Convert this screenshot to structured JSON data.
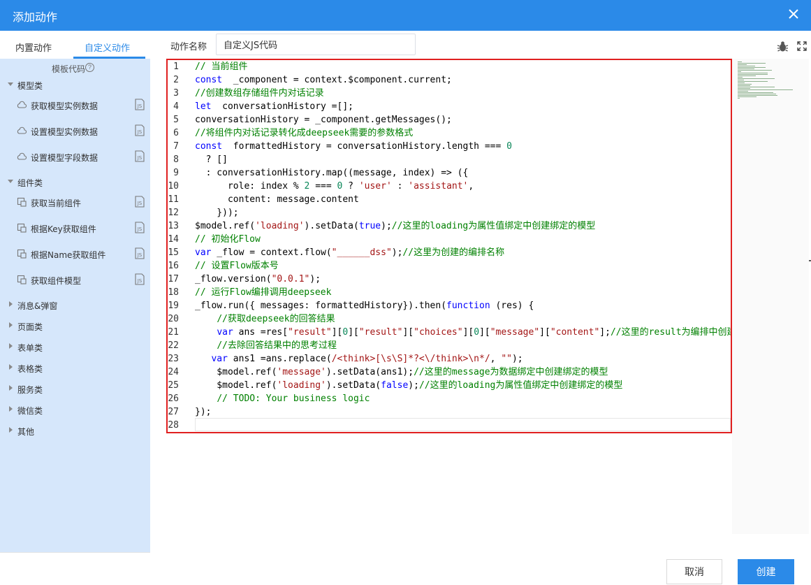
{
  "dialog": {
    "title": "添加动作",
    "cancel_label": "取消",
    "create_label": "创建"
  },
  "sidebar": {
    "tabs": [
      {
        "label": "内置动作",
        "active": false
      },
      {
        "label": "自定义动作",
        "active": true
      }
    ],
    "template_title": "模板代码",
    "help_glyph": "?",
    "categories": [
      {
        "label": "模型类",
        "expanded": true,
        "items": [
          "获取模型实例数据",
          "设置模型实例数据",
          "设置模型字段数据"
        ]
      },
      {
        "label": "组件类",
        "expanded": true,
        "items": [
          "获取当前组件",
          "根据Key获取组件",
          "根据Name获取组件",
          "获取组件模型"
        ]
      },
      {
        "label": "消息&弹窗",
        "expanded": false,
        "items": []
      },
      {
        "label": "页面类",
        "expanded": false,
        "items": []
      },
      {
        "label": "表单类",
        "expanded": false,
        "items": []
      },
      {
        "label": "表格类",
        "expanded": false,
        "items": []
      },
      {
        "label": "服务类",
        "expanded": false,
        "items": []
      },
      {
        "label": "微信类",
        "expanded": false,
        "items": []
      },
      {
        "label": "其他",
        "expanded": false,
        "items": []
      }
    ]
  },
  "action_name": {
    "label": "动作名称",
    "value": "自定义JS代码"
  },
  "editor": {
    "lines": [
      [
        [
          "cm",
          "// 当前组件"
        ]
      ],
      [
        [
          "kw",
          "const"
        ],
        [
          "",
          "  _component = context.$component.current;"
        ]
      ],
      [
        [
          "cm",
          "//创建数组存储组件内对话记录"
        ]
      ],
      [
        [
          "kw",
          "let"
        ],
        [
          "",
          "  conversationHistory =[];"
        ]
      ],
      [
        [
          "",
          "conversationHistory = _component.getMessages();"
        ]
      ],
      [
        [
          "cm",
          "//将组件内对话记录转化成deepseek需要的参数格式"
        ]
      ],
      [
        [
          "kw",
          "const"
        ],
        [
          "",
          "  formattedHistory = conversationHistory.length === "
        ],
        [
          "nm",
          "0"
        ]
      ],
      [
        [
          "",
          "  ? []"
        ]
      ],
      [
        [
          "",
          "  : conversationHistory.map((message, index) => ({"
        ]
      ],
      [
        [
          "",
          "      role: index % "
        ],
        [
          "nm",
          "2"
        ],
        [
          "",
          " === "
        ],
        [
          "nm",
          "0"
        ],
        [
          "",
          " ? "
        ],
        [
          "st",
          "'user'"
        ],
        [
          "",
          " : "
        ],
        [
          "st",
          "'assistant'"
        ],
        [
          "",
          ","
        ]
      ],
      [
        [
          "",
          "      content: message.content"
        ]
      ],
      [
        [
          "",
          "    }));"
        ]
      ],
      [
        [
          "",
          "$model.ref("
        ],
        [
          "st",
          "'loading'"
        ],
        [
          "",
          ").setData("
        ],
        [
          "kw",
          "true"
        ],
        [
          "",
          ");"
        ],
        [
          "cm",
          "//这里的loading为属性值绑定中创建绑定的模型"
        ]
      ],
      [
        [
          "cm",
          "// 初始化Flow"
        ]
      ],
      [
        [
          "kw",
          "var"
        ],
        [
          "",
          " _flow = context.flow("
        ],
        [
          "st",
          "\"______dss\""
        ],
        [
          "",
          ");"
        ],
        [
          "cm",
          "//这里为创建的编排名称"
        ]
      ],
      [
        [
          "cm",
          "// 设置Flow版本号"
        ]
      ],
      [
        [
          "",
          "_flow.version("
        ],
        [
          "st",
          "\"0.0.1\""
        ],
        [
          "",
          ");"
        ]
      ],
      [
        [
          "cm",
          "// 运行Flow编排调用deepseek"
        ]
      ],
      [
        [
          "",
          "_flow.run({ messages: formattedHistory}).then("
        ],
        [
          "kw",
          "function"
        ],
        [
          "",
          " (res) {"
        ]
      ],
      [
        [
          "",
          "    "
        ],
        [
          "cm",
          "//获取deepseek的回答结果"
        ]
      ],
      [
        [
          "",
          "    "
        ],
        [
          "kw",
          "var"
        ],
        [
          "",
          " ans =res["
        ],
        [
          "st",
          "\"result\""
        ],
        [
          "",
          "]["
        ],
        [
          "nm",
          "0"
        ],
        [
          "",
          "]["
        ],
        [
          "st",
          "\"result\""
        ],
        [
          "",
          "]["
        ],
        [
          "st",
          "\"choices\""
        ],
        [
          "",
          "]["
        ],
        [
          "nm",
          "0"
        ],
        [
          "",
          "]["
        ],
        [
          "st",
          "\"message\""
        ],
        [
          "",
          "]["
        ],
        [
          "st",
          "\"content\""
        ],
        [
          "",
          "];"
        ],
        [
          "cm",
          "//这里的result为编排中创建"
        ]
      ],
      [
        [
          "",
          "    "
        ],
        [
          "cm",
          "//去除回答结果中的思考过程"
        ]
      ],
      [
        [
          "",
          "   "
        ],
        [
          "kw",
          "var"
        ],
        [
          "",
          " ans1 =ans.replace("
        ],
        [
          "st",
          "/<think>[\\s\\S]*?<\\/think>\\n*/"
        ],
        [
          "",
          ", "
        ],
        [
          "st",
          "\"\""
        ],
        [
          "",
          ");"
        ]
      ],
      [
        [
          "",
          "    $model.ref("
        ],
        [
          "st",
          "'message'"
        ],
        [
          "",
          ").setData(ans1);"
        ],
        [
          "cm",
          "//这里的message为数据绑定中创建绑定的模型"
        ]
      ],
      [
        [
          "",
          "    $model.ref("
        ],
        [
          "st",
          "'loading'"
        ],
        [
          "",
          ").setData("
        ],
        [
          "kw",
          "false"
        ],
        [
          "",
          ");"
        ],
        [
          "cm",
          "//这里的loading为属性值绑定中创建绑定的模型"
        ]
      ],
      [
        [
          "",
          "    "
        ],
        [
          "cm",
          "// TODO: Your business logic"
        ]
      ],
      [
        [
          "",
          "});"
        ]
      ],
      [
        [
          "",
          ""
        ]
      ]
    ]
  }
}
